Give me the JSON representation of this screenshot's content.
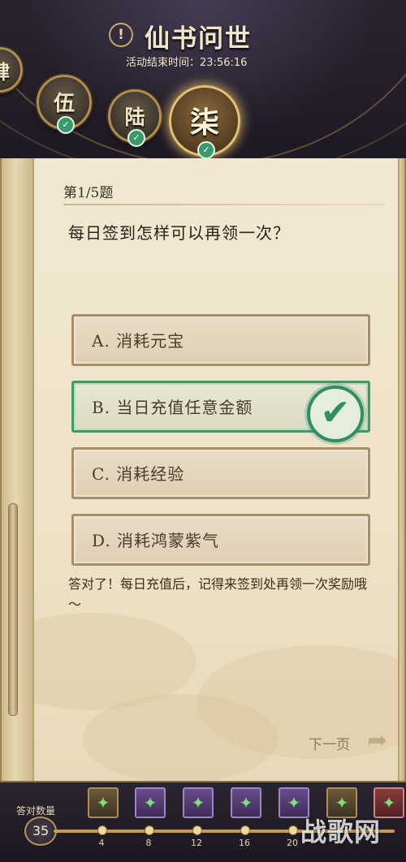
{
  "header": {
    "title": "仙书问世",
    "info_icon": "!",
    "timer_label": "活动结束时间：",
    "timer_value": "23:56:16"
  },
  "chapters": [
    {
      "label": "肆",
      "completed": true
    },
    {
      "label": "伍",
      "completed": true
    },
    {
      "label": "陆",
      "completed": true
    },
    {
      "label": "柒",
      "completed": true,
      "selected": true
    }
  ],
  "quiz": {
    "progress": "第1/5题",
    "question": "每日签到怎样可以再领一次？",
    "options": [
      {
        "text": "A. 消耗元宝",
        "correct": false
      },
      {
        "text": "B. 当日充值任意金额",
        "correct": true
      },
      {
        "text": "C. 消耗经验",
        "correct": false
      },
      {
        "text": "D. 消耗鸿蒙紫气",
        "correct": false
      }
    ],
    "correct_mark": "✔",
    "feedback": "答对了！每日充值后，记得来签到处再领一次奖励哦～",
    "next_label": "下一页",
    "next_icon": "arrow-icon"
  },
  "progress_bar": {
    "label": "答对数量",
    "count": "35",
    "milestones": [
      "4",
      "8",
      "12",
      "16",
      "20"
    ],
    "rewards": [
      "reward-icon",
      "reward-icon",
      "reward-icon",
      "reward-icon",
      "reward-icon",
      "reward-icon",
      "reward-icon"
    ]
  },
  "watermark": "战歌网",
  "colors": {
    "correct_green": "#2f8e63",
    "parchment": "#f2e8d2",
    "gold_trim": "#b08e52"
  }
}
